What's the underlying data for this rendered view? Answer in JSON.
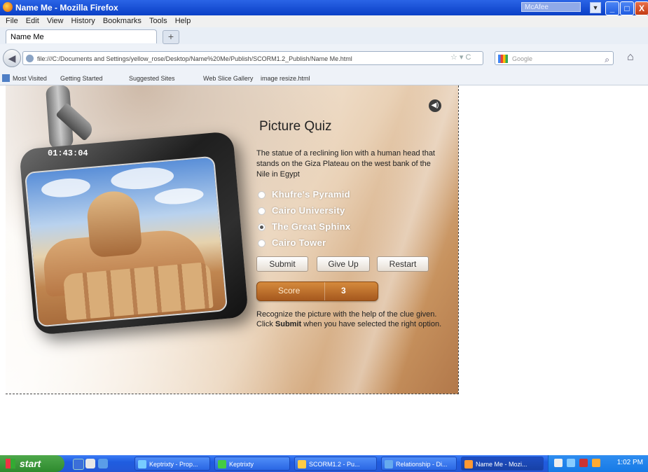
{
  "window": {
    "title": "Name Me - Mozilla Firefox",
    "mcafee_label": "McAfee",
    "minimize": "_",
    "maximize": "□",
    "close": "X"
  },
  "menu": [
    "File",
    "Edit",
    "View",
    "History",
    "Bookmarks",
    "Tools",
    "Help"
  ],
  "tab": {
    "label": "Name Me",
    "new_tab": "+"
  },
  "nav": {
    "url": "file:///C:/Documents and Settings/yellow_rose/Desktop/Name%20Me/Publish/SCORM1.2_Publish/Name Me.html",
    "search_placeholder": "Google",
    "url_icons": "☆ ▾ C"
  },
  "bookmarks": [
    "Most Visited",
    "Getting Started",
    "Suggested Sites",
    "Web Slice Gallery",
    "image resize.html"
  ],
  "quiz": {
    "timer": "01:43:04",
    "title": "Picture Quiz",
    "clue": "The statue of a reclining lion with a human head that stands on the Giza Plateau on the west bank of the Nile in Egypt",
    "options": [
      {
        "label": "Khufre's Pyramid",
        "selected": false
      },
      {
        "label": "Cairo University",
        "selected": false
      },
      {
        "label": "The Great Sphinx",
        "selected": true
      },
      {
        "label": "Cairo Tower",
        "selected": false
      }
    ],
    "buttons": {
      "submit": "Submit",
      "give_up": "Give Up",
      "restart": "Restart"
    },
    "score_label": "Score",
    "score_value": "3",
    "hint_pre": "Recognize the picture with the help of the clue given. Click ",
    "hint_bold": "Submit",
    "hint_post": " when you have selected the right option."
  },
  "taskbar": {
    "start": "start",
    "tasks": [
      "Keptrixty - Prop...",
      "Keptrixty",
      "SCORM1.2 - Pu...",
      "Relationship - Di...",
      "Name Me - Mozi..."
    ],
    "clock": "1:02 PM"
  },
  "colors": {
    "accent": "#1f5de0",
    "score": "#b8692a",
    "stage_brown": "#b2784a"
  }
}
